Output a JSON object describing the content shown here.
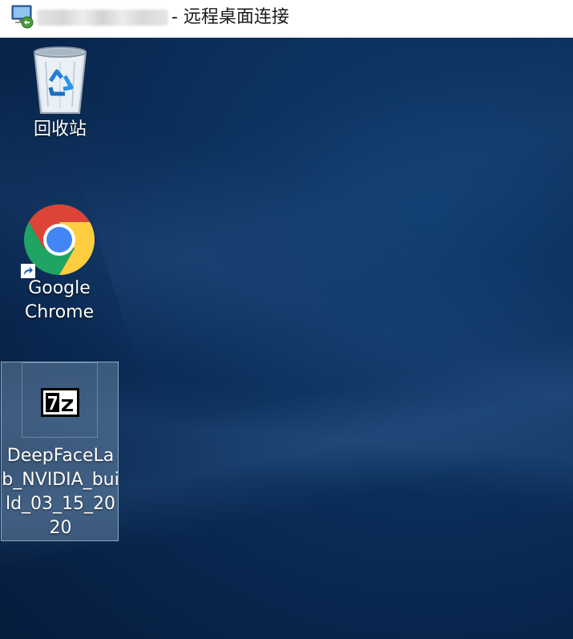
{
  "window": {
    "title_suffix": "- 远程桌面连接",
    "app_icon": "remote-desktop-icon"
  },
  "desktop": {
    "icons": [
      {
        "label": "回收站",
        "icon": "recycle-bin-icon"
      },
      {
        "label": "Google\nChrome",
        "icon": "chrome-icon"
      },
      {
        "label": "DeepFaceLab_NVIDIA_build_03_15_2020",
        "icon": "7zip-archive-icon"
      }
    ]
  },
  "colors": {
    "desktop_background": "#0b2f5a",
    "selection_fill": "#7896b4",
    "text": "#ffffff"
  }
}
